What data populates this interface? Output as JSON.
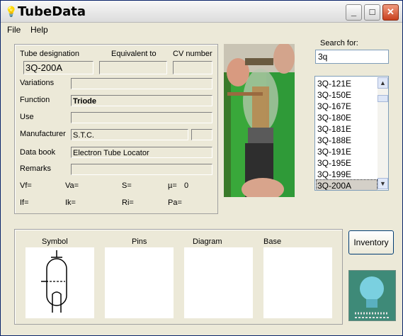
{
  "window": {
    "title": "TubeData",
    "icons": {
      "app": "lightbulb-icon",
      "minimize": "minimize-icon",
      "maximize": "maximize-icon",
      "close": "close-icon"
    }
  },
  "menu": {
    "file": "File",
    "help": "Help"
  },
  "details": {
    "tube_designation_label": "Tube designation",
    "tube_designation_value": "3Q-200A",
    "equivalent_label": "Equivalent to",
    "equivalent_value": "",
    "cv_label": "CV number",
    "cv_value": "",
    "variations_label": "Variations",
    "variations_value": "",
    "function_label": "Function",
    "function_value": "Triode",
    "use_label": "Use",
    "use_value": "",
    "manufacturer_label": "Manufacturer",
    "manufacturer_value": "S.T.C.",
    "manufacturer_extra": "",
    "databook_label": "Data book",
    "databook_value": "Electron Tube Locator",
    "remarks_label": "Remarks",
    "remarks_value": ""
  },
  "params": {
    "vf": "Vf=",
    "va": "Va=",
    "s": "S=",
    "mu": "µ=",
    "mu_value": "0",
    "if": "If=",
    "ik": "Ik=",
    "ri": "Ri=",
    "pa": "Pa="
  },
  "search": {
    "label": "Search for:",
    "value": "3q",
    "results": [
      "3Q-121E",
      "3Q-150E",
      "3Q-167E",
      "3Q-180E",
      "3Q-181E",
      "3Q-188E",
      "3Q-191E",
      "3Q-195E",
      "3Q-199E",
      "3Q-200A"
    ],
    "selected_index": 9
  },
  "panels": {
    "symbol": "Symbol",
    "pins": "Pins",
    "diagram": "Diagram",
    "base": "Base"
  },
  "buttons": {
    "inventory": "Inventory"
  },
  "colors": {
    "title_bg": "#e6e6e6",
    "close_red": "#c8401e",
    "sweater_green": "#3aa23a",
    "window_bg": "#ece9d8"
  }
}
